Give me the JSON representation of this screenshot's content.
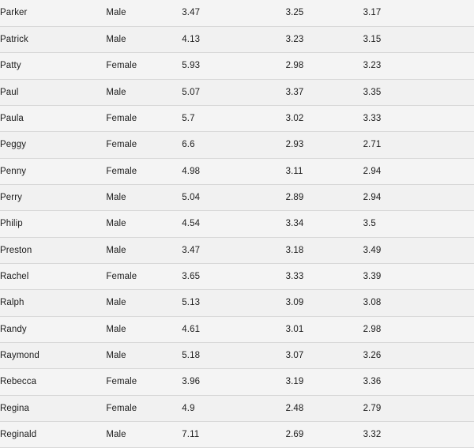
{
  "table": {
    "columns": [
      "name",
      "gender",
      "value1",
      "value2",
      "value3"
    ],
    "rows": [
      {
        "name": "Parker",
        "gender": "Male",
        "value1": "3.47",
        "value2": "3.25",
        "value3": "3.17"
      },
      {
        "name": "Patrick",
        "gender": "Male",
        "value1": "4.13",
        "value2": "3.23",
        "value3": "3.15"
      },
      {
        "name": "Patty",
        "gender": "Female",
        "value1": "5.93",
        "value2": "2.98",
        "value3": "3.23"
      },
      {
        "name": "Paul",
        "gender": "Male",
        "value1": "5.07",
        "value2": "3.37",
        "value3": "3.35"
      },
      {
        "name": "Paula",
        "gender": "Female",
        "value1": "5.7",
        "value2": "3.02",
        "value3": "3.33"
      },
      {
        "name": "Peggy",
        "gender": "Female",
        "value1": "6.6",
        "value2": "2.93",
        "value3": "2.71"
      },
      {
        "name": "Penny",
        "gender": "Female",
        "value1": "4.98",
        "value2": "3.11",
        "value3": "2.94"
      },
      {
        "name": "Perry",
        "gender": "Male",
        "value1": "5.04",
        "value2": "2.89",
        "value3": "2.94"
      },
      {
        "name": "Philip",
        "gender": "Male",
        "value1": "4.54",
        "value2": "3.34",
        "value3": "3.5"
      },
      {
        "name": "Preston",
        "gender": "Male",
        "value1": "3.47",
        "value2": "3.18",
        "value3": "3.49"
      },
      {
        "name": "Rachel",
        "gender": "Female",
        "value1": "3.65",
        "value2": "3.33",
        "value3": "3.39"
      },
      {
        "name": "Ralph",
        "gender": "Male",
        "value1": "5.13",
        "value2": "3.09",
        "value3": "3.08"
      },
      {
        "name": "Randy",
        "gender": "Male",
        "value1": "4.61",
        "value2": "3.01",
        "value3": "2.98"
      },
      {
        "name": "Raymond",
        "gender": "Male",
        "value1": "5.18",
        "value2": "3.07",
        "value3": "3.26"
      },
      {
        "name": "Rebecca",
        "gender": "Female",
        "value1": "3.96",
        "value2": "3.19",
        "value3": "3.36"
      },
      {
        "name": "Regina",
        "gender": "Female",
        "value1": "4.9",
        "value2": "2.48",
        "value3": "2.79"
      },
      {
        "name": "Reginald",
        "gender": "Male",
        "value1": "7.11",
        "value2": "2.69",
        "value3": "3.32"
      }
    ]
  },
  "colors": {
    "row_background": "#f4f4f4",
    "row_background_alt": "#f1f1f1",
    "row_border": "#d8d8d8",
    "text": "#1b1b1b"
  }
}
